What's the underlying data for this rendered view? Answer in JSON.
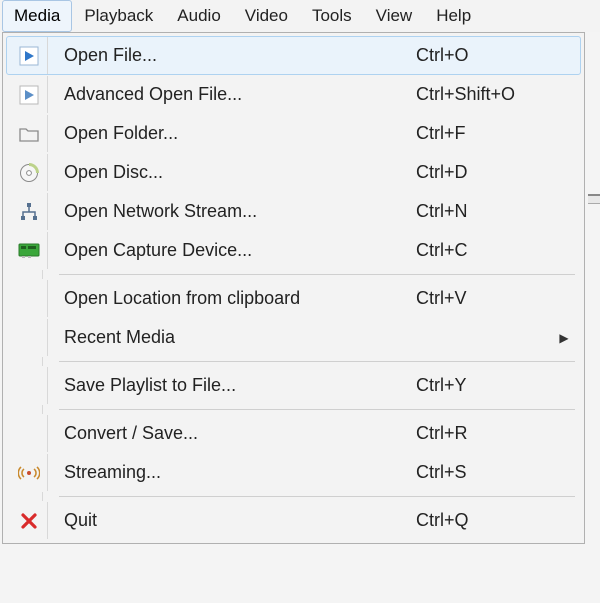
{
  "menubar": {
    "items": [
      {
        "label": "Media",
        "active": true
      },
      {
        "label": "Playback",
        "active": false
      },
      {
        "label": "Audio",
        "active": false
      },
      {
        "label": "Video",
        "active": false
      },
      {
        "label": "Tools",
        "active": false
      },
      {
        "label": "View",
        "active": false
      },
      {
        "label": "Help",
        "active": false
      }
    ]
  },
  "menu": {
    "open_file": {
      "label": "Open File...",
      "accel": "Ctrl+O"
    },
    "adv_open_file": {
      "label": "Advanced Open File...",
      "accel": "Ctrl+Shift+O"
    },
    "open_folder": {
      "label": "Open Folder...",
      "accel": "Ctrl+F"
    },
    "open_disc": {
      "label": "Open Disc...",
      "accel": "Ctrl+D"
    },
    "open_network": {
      "label": "Open Network Stream...",
      "accel": "Ctrl+N"
    },
    "open_capture": {
      "label": "Open Capture Device...",
      "accel": "Ctrl+C"
    },
    "open_clipboard": {
      "label": "Open Location from clipboard",
      "accel": "Ctrl+V"
    },
    "recent_media": {
      "label": "Recent Media",
      "accel": ""
    },
    "save_playlist": {
      "label": "Save Playlist to File...",
      "accel": "Ctrl+Y"
    },
    "convert_save": {
      "label": "Convert / Save...",
      "accel": "Ctrl+R"
    },
    "streaming": {
      "label": "Streaming...",
      "accel": "Ctrl+S"
    },
    "quit": {
      "label": "Quit",
      "accel": "Ctrl+Q"
    }
  }
}
